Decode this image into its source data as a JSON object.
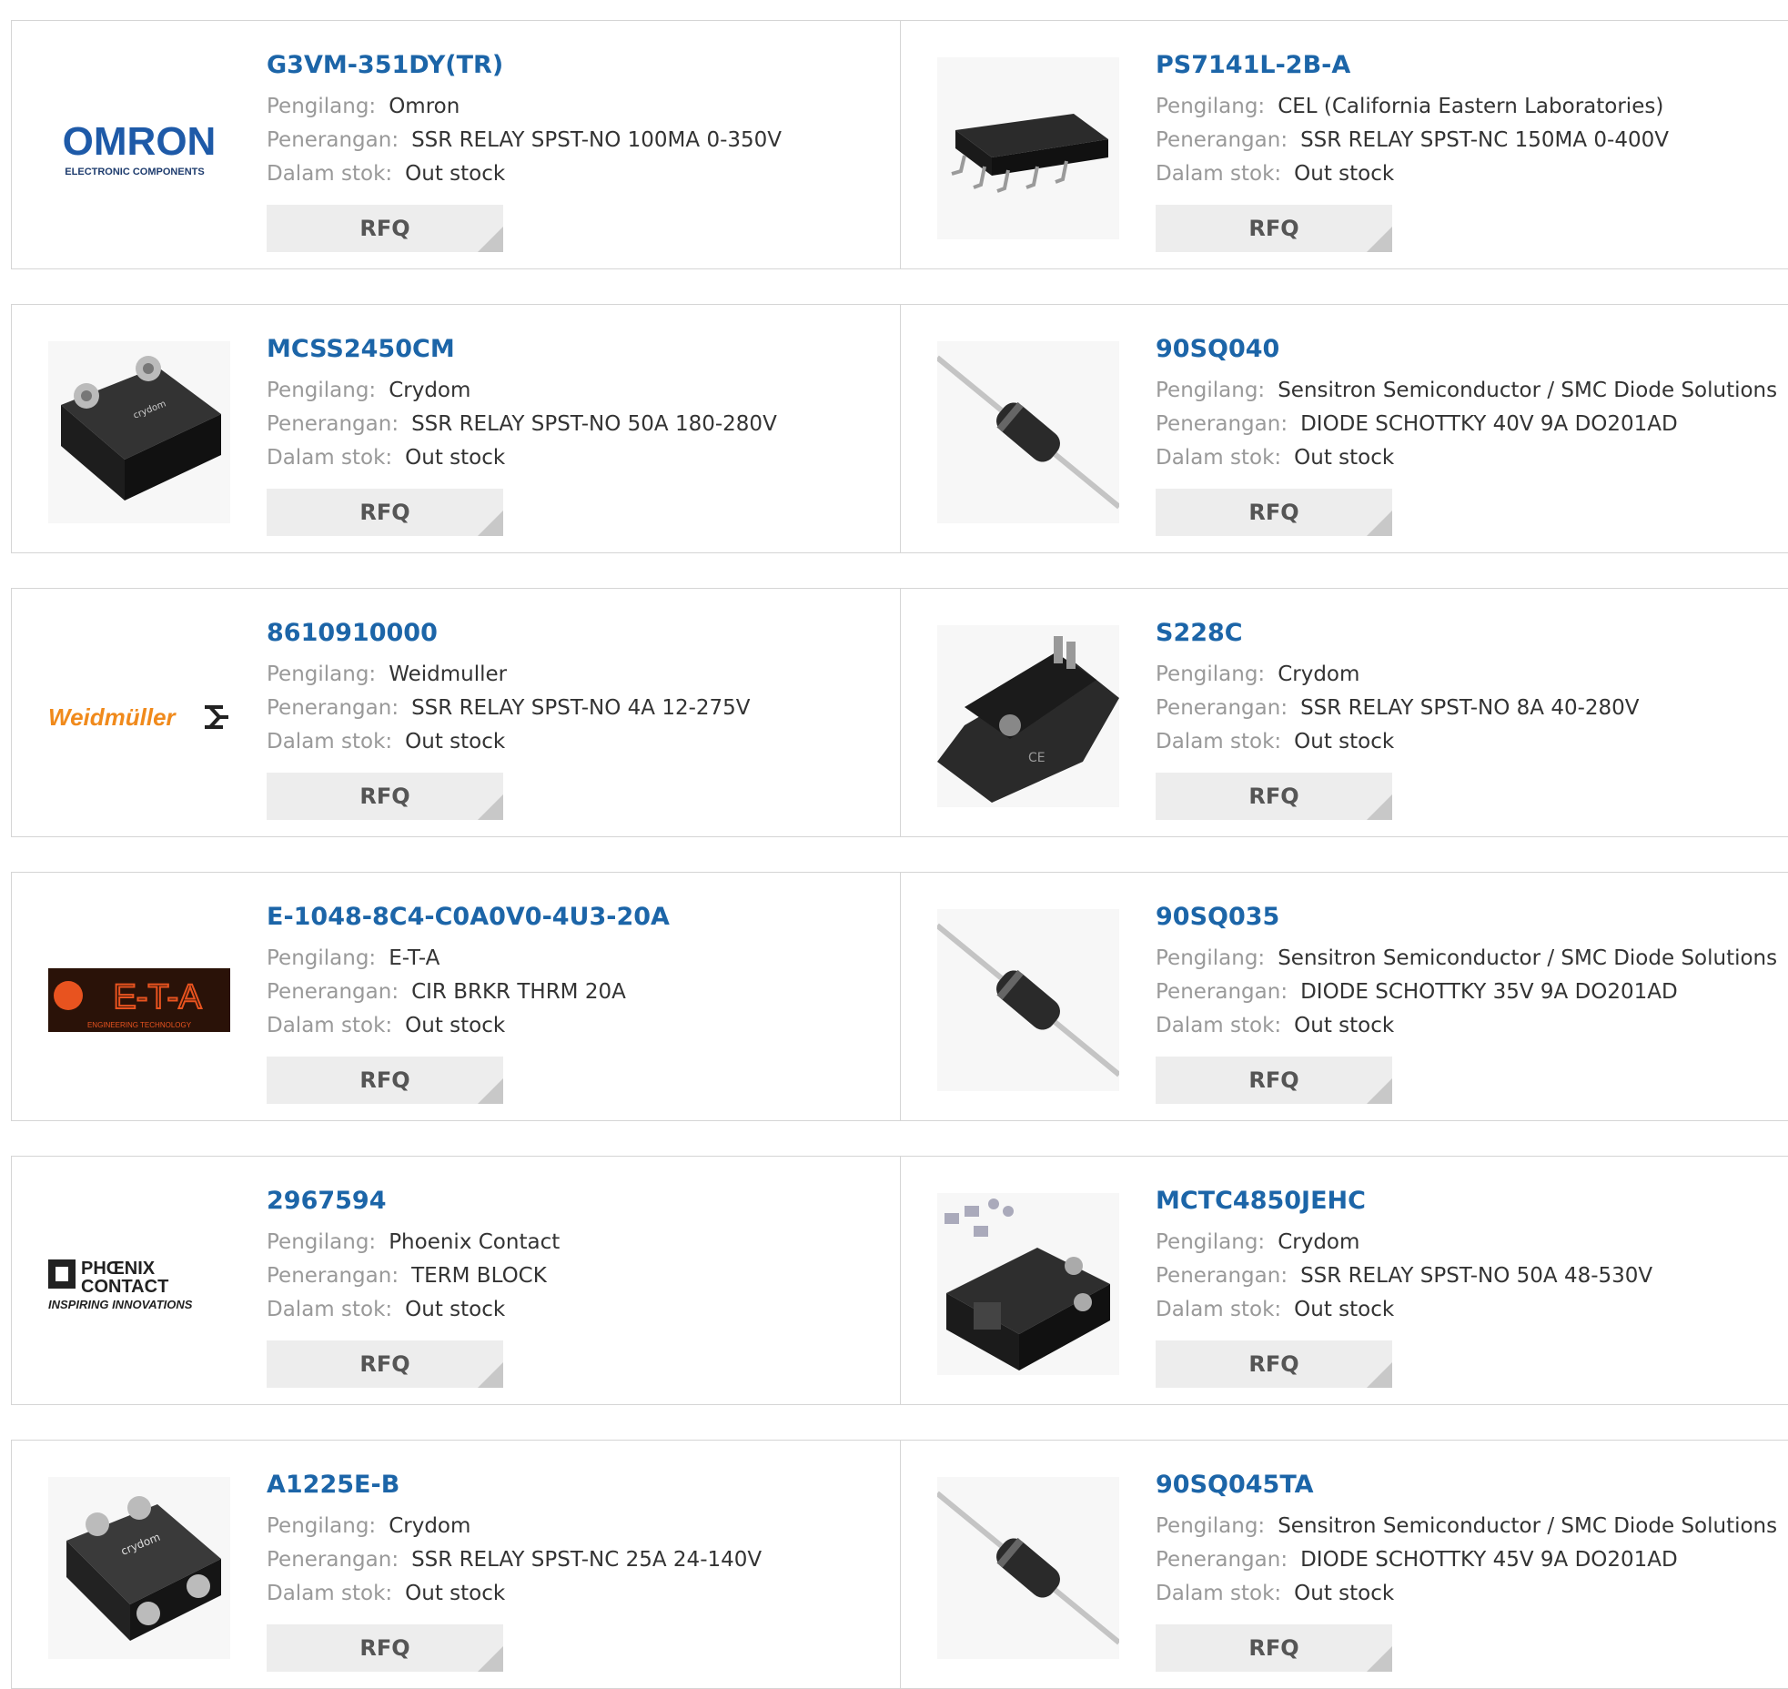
{
  "labels": {
    "manufacturer": "Pengilang:",
    "description": "Penerangan:",
    "stock": "Dalam stok:",
    "rfq": "RFQ"
  },
  "products": [
    {
      "part": "G3VM-351DY(TR)",
      "manufacturer": "Omron",
      "description": "SSR RELAY SPST-NO 100MA 0-350V",
      "stock": "Out stock",
      "thumb": "omron-logo"
    },
    {
      "part": "PS7141L-2B-A",
      "manufacturer": "CEL (California Eastern Laboratories)",
      "description": "SSR RELAY SPST-NC 150MA 0-400V",
      "stock": "Out stock",
      "thumb": "ic-chip-image"
    },
    {
      "part": "MCSS2450CM",
      "manufacturer": "Crydom",
      "description": "SSR RELAY SPST-NO 50A 180-280V",
      "stock": "Out stock",
      "thumb": "ssr-relay-image"
    },
    {
      "part": "90SQ040",
      "manufacturer": "Sensitron Semiconductor / SMC Diode Solutions",
      "description": "DIODE SCHOTTKY 40V 9A DO201AD",
      "stock": "Out stock",
      "thumb": "diode-image"
    },
    {
      "part": "8610910000",
      "manufacturer": "Weidmuller",
      "description": "SSR RELAY SPST-NO 4A 12-275V",
      "stock": "Out stock",
      "thumb": "weidmuller-logo"
    },
    {
      "part": "S228C",
      "manufacturer": "Crydom",
      "description": "SSR RELAY SPST-NO 8A 40-280V",
      "stock": "Out stock",
      "thumb": "ssr-relay-image"
    },
    {
      "part": "E-1048-8C4-C0A0V0-4U3-20A",
      "manufacturer": "E-T-A",
      "description": "CIR BRKR THRM 20A",
      "stock": "Out stock",
      "thumb": "eta-logo"
    },
    {
      "part": "90SQ035",
      "manufacturer": "Sensitron Semiconductor / SMC Diode Solutions",
      "description": "DIODE SCHOTTKY 35V 9A DO201AD",
      "stock": "Out stock",
      "thumb": "diode-image"
    },
    {
      "part": "2967594",
      "manufacturer": "Phoenix Contact",
      "description": "TERM BLOCK",
      "stock": "Out stock",
      "thumb": "phoenix-contact-logo"
    },
    {
      "part": "MCTC4850JEHC",
      "manufacturer": "Crydom",
      "description": "SSR RELAY SPST-NO 50A 48-530V",
      "stock": "Out stock",
      "thumb": "ssr-relay-image"
    },
    {
      "part": "A1225E-B",
      "manufacturer": "Crydom",
      "description": "SSR RELAY SPST-NC 25A 24-140V",
      "stock": "Out stock",
      "thumb": "ssr-relay-image"
    },
    {
      "part": "90SQ045TA",
      "manufacturer": "Sensitron Semiconductor / SMC Diode Solutions",
      "description": "DIODE SCHOTTKY 45V 9A DO201AD",
      "stock": "Out stock",
      "thumb": "diode-image"
    }
  ],
  "logos": {
    "omron": {
      "text": "OMRON",
      "sub": "ELECTRONIC COMPONENTS",
      "color": "#1e5aa8"
    },
    "weidmuller": {
      "text": "Weidmüller",
      "color": "#f08a1c"
    },
    "eta": {
      "text": "E-T-A",
      "sub": "ENGINEERING TECHNOLOGY",
      "color": "#e8531f"
    },
    "phoenix": {
      "text1": "PHŒNIX",
      "text2": "CONTACT",
      "sub": "INSPIRING INNOVATIONS"
    }
  },
  "colors": {
    "link": "#1c65a8",
    "label": "#999999",
    "button": "#ededed"
  }
}
